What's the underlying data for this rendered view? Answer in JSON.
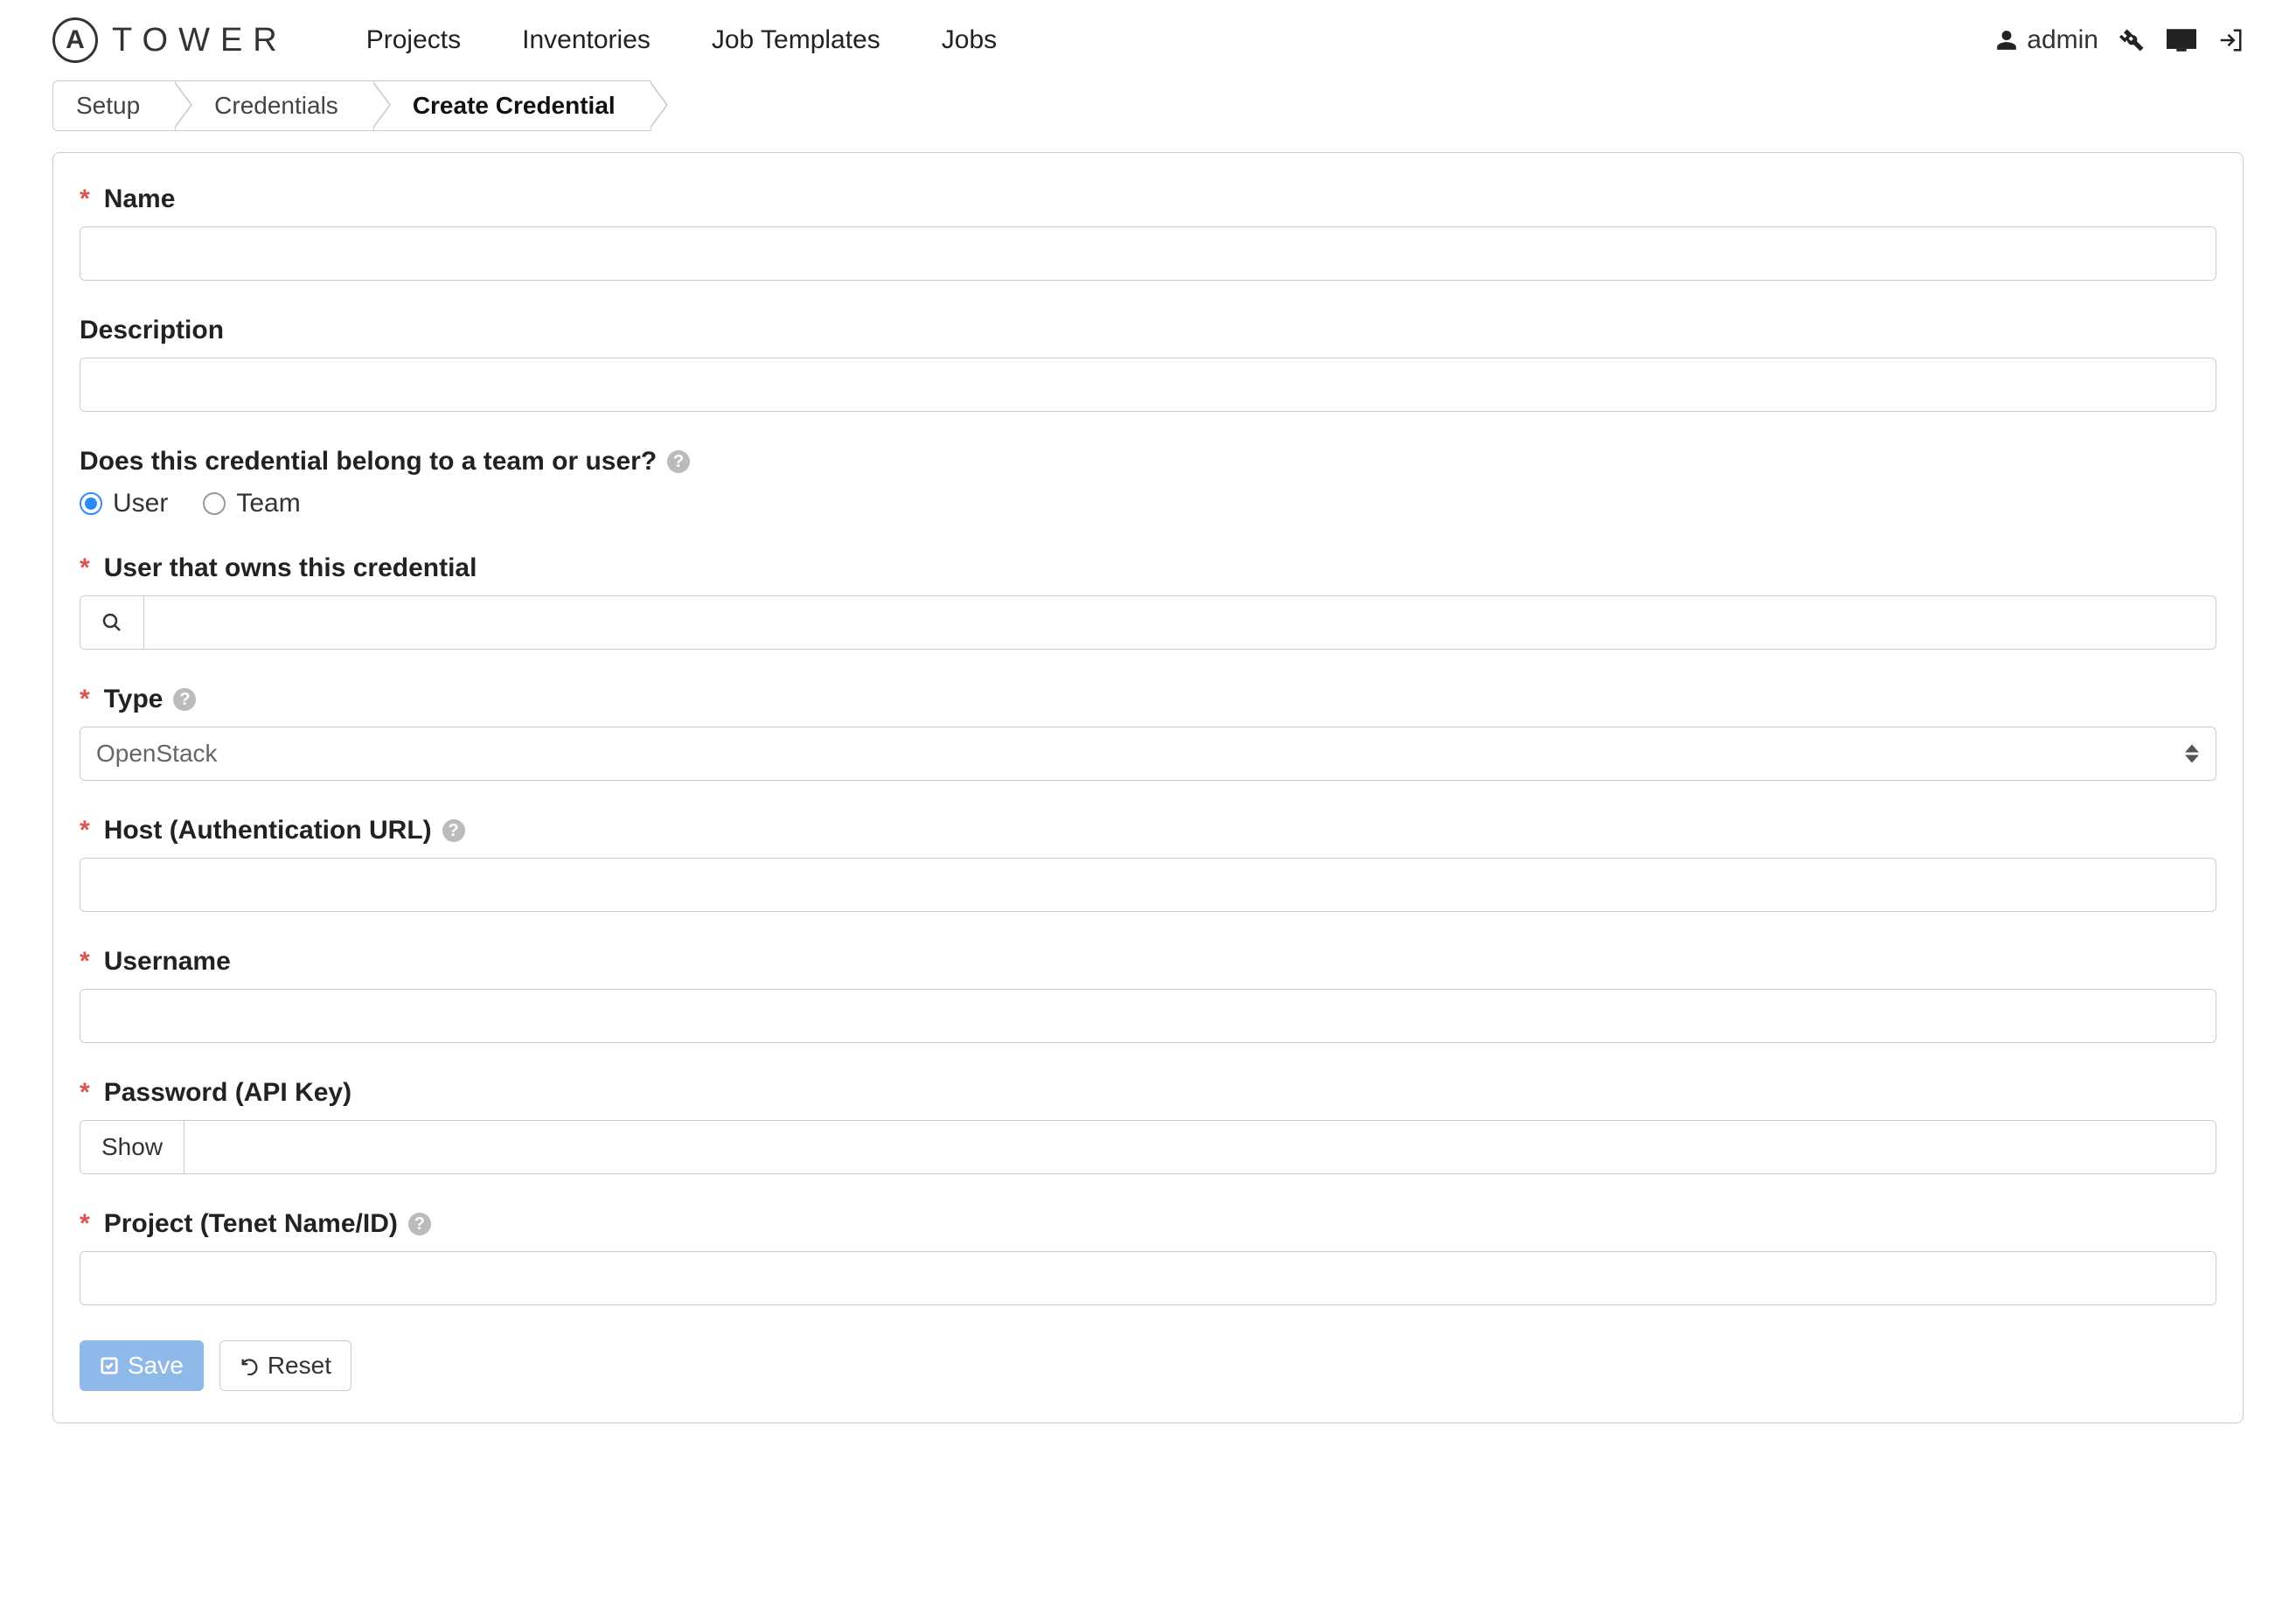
{
  "brand": {
    "mark": "A",
    "text": "TOWER"
  },
  "nav": {
    "items": [
      "Projects",
      "Inventories",
      "Job Templates",
      "Jobs"
    ]
  },
  "user": {
    "name": "admin"
  },
  "breadcrumb": {
    "items": [
      "Setup",
      "Credentials",
      "Create Credential"
    ],
    "activeIndex": 2
  },
  "form": {
    "name": {
      "label": "Name",
      "required": true,
      "value": ""
    },
    "description": {
      "label": "Description",
      "required": false,
      "value": ""
    },
    "ownership": {
      "label": "Does this credential belong to a team or user?",
      "options": [
        "User",
        "Team"
      ],
      "selected": "User"
    },
    "owner": {
      "label": "User that owns this credential",
      "required": true,
      "value": ""
    },
    "type": {
      "label": "Type",
      "required": true,
      "value": "OpenStack"
    },
    "host": {
      "label": "Host (Authentication URL)",
      "required": true,
      "value": ""
    },
    "username": {
      "label": "Username",
      "required": true,
      "value": ""
    },
    "password": {
      "label": "Password (API Key)",
      "required": true,
      "show_label": "Show",
      "value": ""
    },
    "project": {
      "label": "Project (Tenet Name/ID)",
      "required": true,
      "value": ""
    }
  },
  "buttons": {
    "save": "Save",
    "reset": "Reset"
  }
}
